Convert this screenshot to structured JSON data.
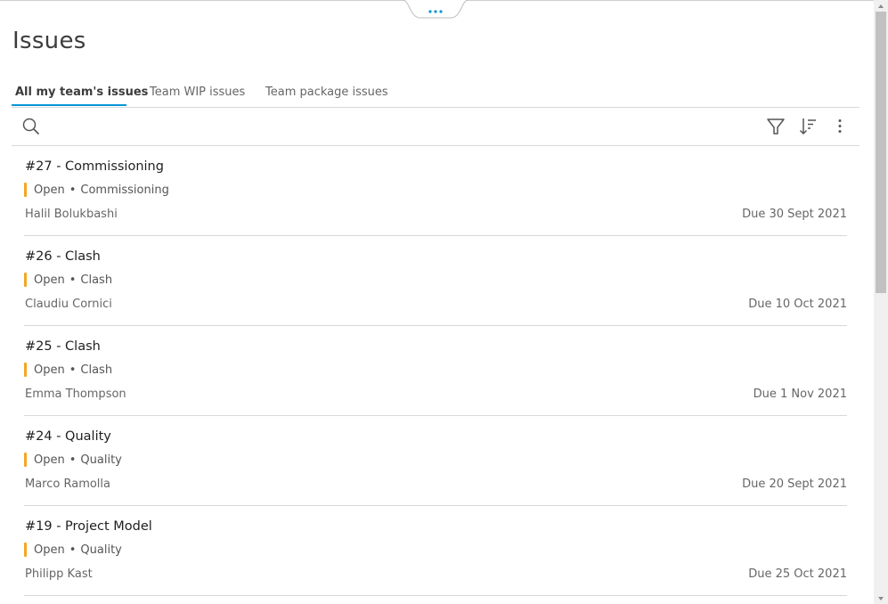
{
  "page": {
    "title": "Issues"
  },
  "tabs": [
    {
      "label": "All my team's issues",
      "active": true
    },
    {
      "label": "Team WIP issues",
      "active": false
    },
    {
      "label": "Team package issues",
      "active": false
    }
  ],
  "toolbar": {
    "search_icon": "search-icon",
    "filter_icon": "filter-icon",
    "sort_icon": "sort-icon",
    "more_icon": "more-vertical-icon"
  },
  "colors": {
    "accent": "#0696d7",
    "status_open": "#f5a623"
  },
  "issues": [
    {
      "title": "#27 - Commissioning",
      "status": "Open",
      "type": "Commissioning",
      "assignee": "Halil Bolukbashi",
      "due": "Due 30 Sept 2021"
    },
    {
      "title": "#26 - Clash",
      "status": "Open",
      "type": "Clash",
      "assignee": "Claudiu Cornici",
      "due": "Due 10 Oct 2021"
    },
    {
      "title": "#25 - Clash",
      "status": "Open",
      "type": "Clash",
      "assignee": "Emma Thompson",
      "due": "Due 1 Nov 2021"
    },
    {
      "title": "#24 - Quality",
      "status": "Open",
      "type": "Quality",
      "assignee": "Marco Ramolla",
      "due": "Due 20 Sept 2021"
    },
    {
      "title": "#19 - Project Model",
      "status": "Open",
      "type": "Quality",
      "assignee": "Philipp Kast",
      "due": "Due 25 Oct 2021"
    }
  ]
}
